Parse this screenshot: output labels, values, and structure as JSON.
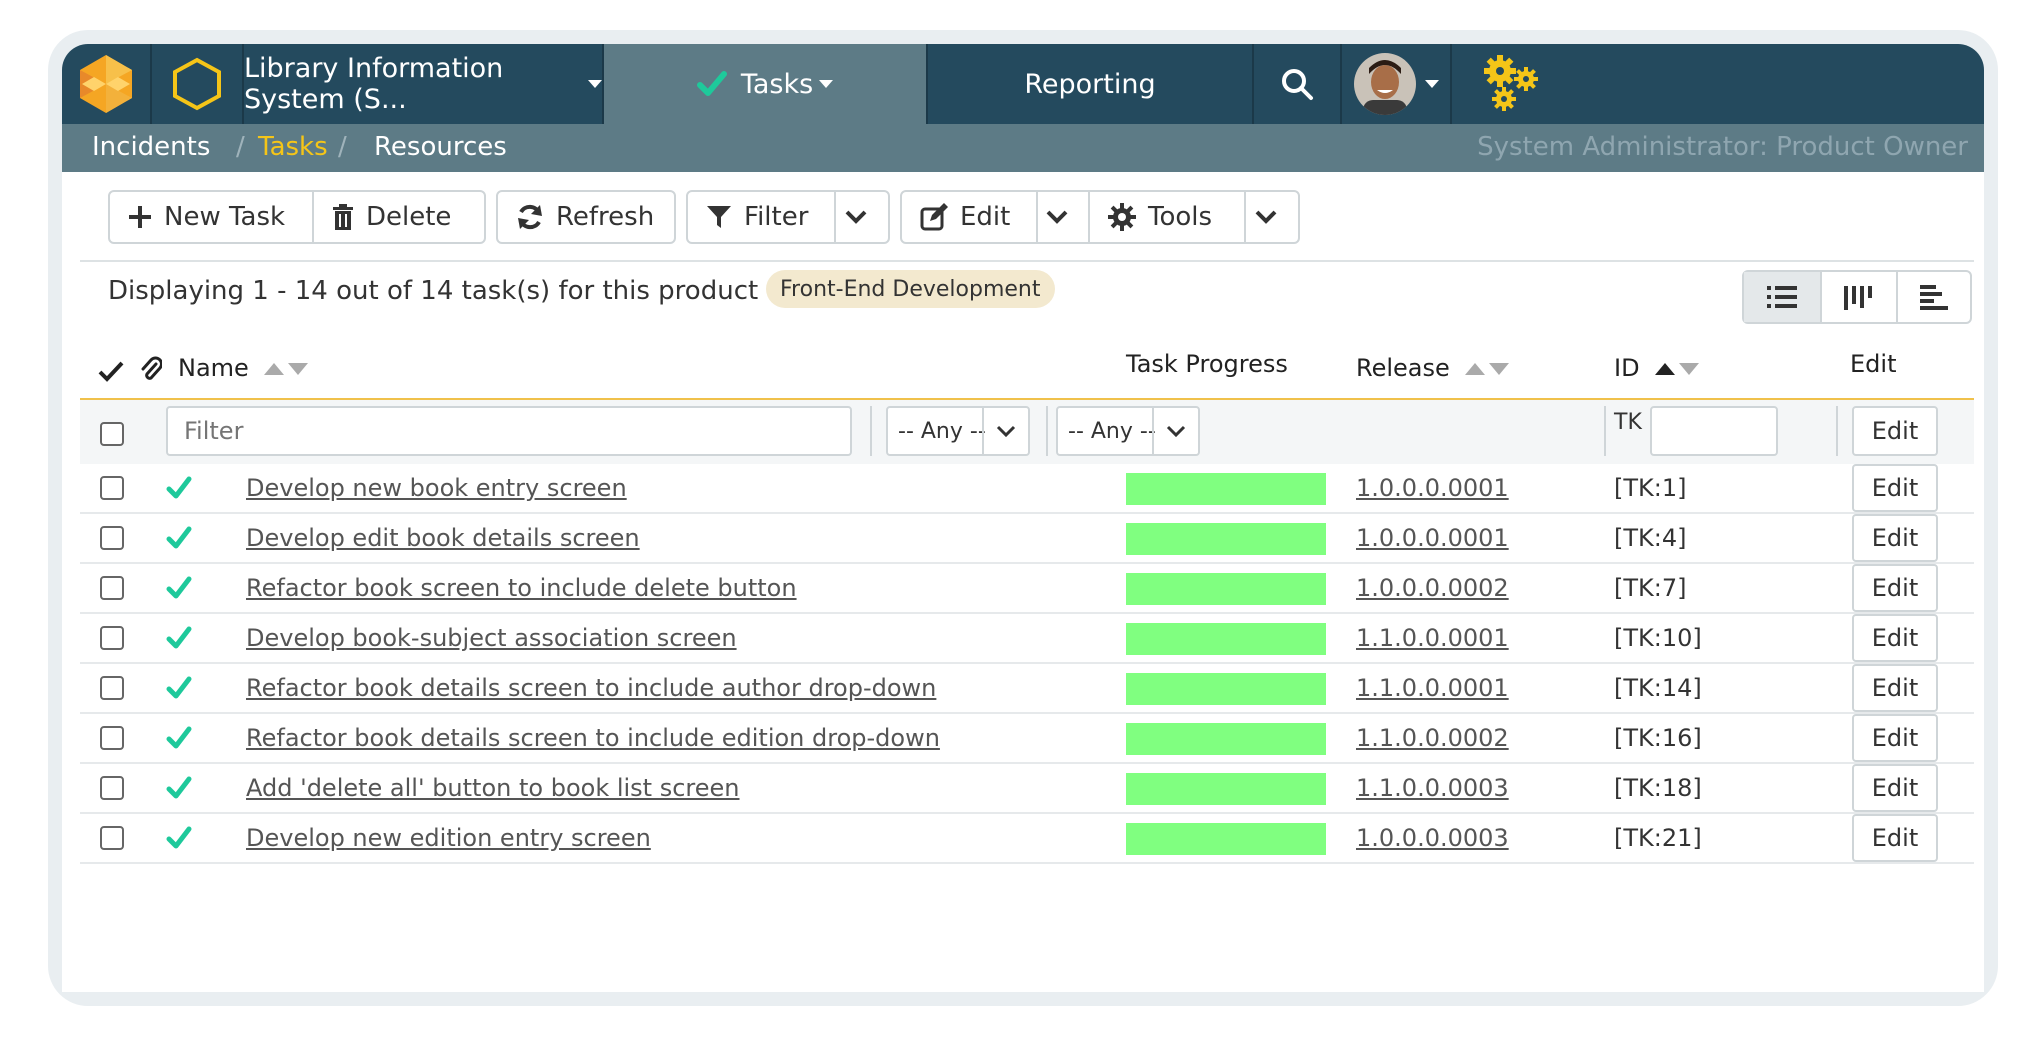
{
  "topnav": {
    "project_name": "Library Information System (S...",
    "tasks_label": "Tasks",
    "reporting_label": "Reporting"
  },
  "subnav": {
    "incidents": "Incidents",
    "sep1": "/",
    "tasks": "Tasks",
    "sep2": "/",
    "resources": "Resources",
    "role": "System Administrator: Product Owner"
  },
  "toolbar": {
    "new_task": "New Task",
    "delete": "Delete",
    "refresh": "Refresh",
    "filter": "Filter",
    "edit": "Edit",
    "tools": "Tools"
  },
  "summary": {
    "text": "Displaying 1 - 14 out of 14 task(s) for this product",
    "component_badge": "Front-End Development"
  },
  "table": {
    "headers": {
      "name": "Name",
      "progress": "Task Progress",
      "release": "Release",
      "id": "ID",
      "edit": "Edit"
    },
    "filters": {
      "name_placeholder": "Filter",
      "progress_value": "-- Any --",
      "release_value": "-- Any --",
      "id_prefix": "TK",
      "edit_label": "Edit"
    },
    "rows": [
      {
        "name": "Develop new book entry screen",
        "progress": 1.0,
        "release": "1.0.0.0.0001",
        "id": "[TK:1]",
        "edit": "Edit"
      },
      {
        "name": "Develop edit book details screen",
        "progress": 1.0,
        "release": "1.0.0.0.0001",
        "id": "[TK:4]",
        "edit": "Edit"
      },
      {
        "name": "Refactor book screen to include delete button",
        "progress": 1.0,
        "release": "1.0.0.0.0002",
        "id": "[TK:7]",
        "edit": "Edit"
      },
      {
        "name": "Develop book-subject association screen",
        "progress": 1.0,
        "release": "1.1.0.0.0001",
        "id": "[TK:10]",
        "edit": "Edit"
      },
      {
        "name": "Refactor book details screen to include author drop-down",
        "progress": 1.0,
        "release": "1.1.0.0.0001",
        "id": "[TK:14]",
        "edit": "Edit"
      },
      {
        "name": "Refactor book details screen to include edition drop-down",
        "progress": 1.0,
        "release": "1.1.0.0.0002",
        "id": "[TK:16]",
        "edit": "Edit"
      },
      {
        "name": "Add 'delete all' button to book list screen",
        "progress": 1.0,
        "release": "1.1.0.0.0003",
        "id": "[TK:18]",
        "edit": "Edit"
      },
      {
        "name": "Develop new edition entry screen",
        "progress": 1.0,
        "release": "1.0.0.0.0003",
        "id": "[TK:21]",
        "edit": "Edit"
      }
    ]
  },
  "colors": {
    "nav_bg": "#244a5e",
    "subnav_bg": "#5d7b86",
    "accent_yellow": "#f5c518",
    "progress_green": "#80ff80",
    "check_green": "#1ec99b"
  },
  "icons": [
    "app-logo-icon",
    "hexagon-icon",
    "check-icon",
    "search-icon",
    "avatar",
    "gears-icon",
    "plus-icon",
    "trash-icon",
    "refresh-icon",
    "funnel-icon",
    "edit-icon",
    "gear-icon",
    "chevron-down-icon",
    "list-view-icon",
    "board-view-icon",
    "gantt-view-icon",
    "paperclip-icon"
  ]
}
